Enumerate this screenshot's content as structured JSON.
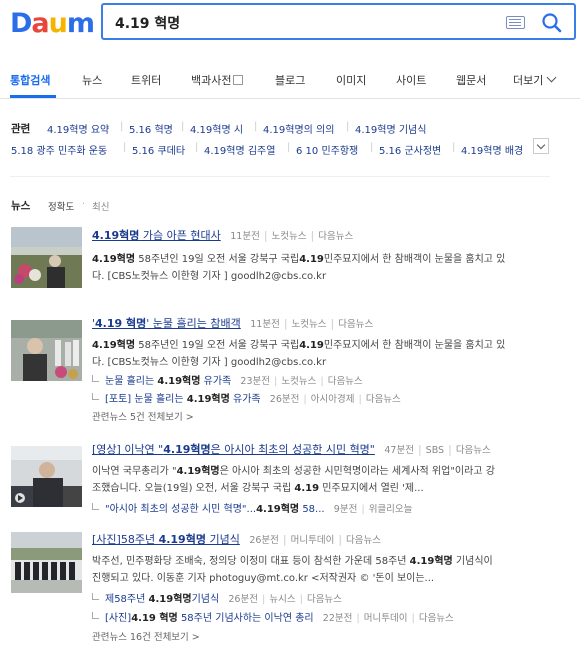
{
  "logo": {
    "letters": [
      "D",
      "a",
      "u",
      "m"
    ],
    "colors": [
      "#2b6ee8",
      "#e8463a",
      "#f4b400",
      "#2b6ee8"
    ]
  },
  "search": {
    "value": "4.19 혁명"
  },
  "tabs": [
    {
      "label": "통합검색",
      "active": true
    },
    {
      "label": "뉴스"
    },
    {
      "label": "트위터"
    },
    {
      "label": "백과사전"
    },
    {
      "label": "블로그"
    },
    {
      "label": "이미지"
    },
    {
      "label": "사이트"
    },
    {
      "label": "웹문서"
    },
    {
      "label": "더보기"
    }
  ],
  "related": {
    "title": "관련",
    "row1": [
      "4.19혁명 요약",
      "5.16 혁명",
      "4.19혁명 시",
      "4.19혁명의 의의",
      "4.19혁명 기념식"
    ],
    "row2": [
      "5.18 광주 민주화 운동",
      "5.16 쿠데타",
      "4.19혁명 김주열",
      "6 10 민주항쟁",
      "5.16 군사정변",
      "4.19혁명 배경"
    ]
  },
  "news": {
    "heading": "뉴스",
    "sort_accuracy": "정확도",
    "sort_recent": "최신",
    "items": [
      {
        "title": "4.19혁명 가슴 아픈 현대사",
        "time": "11분전",
        "source": "노컷뉴스",
        "daum": "다음뉴스",
        "lines": [
          "4.19혁명 58주년인 19일 오전 서울 강북구 국립4.19민주묘지에서 한 참배객이 눈물을 훔치고 있",
          "다. [CBS노컷뉴스 이한형 기자 ] goodlh2@cbs.co.kr"
        ]
      },
      {
        "title": "'4.19 혁명' 눈물 흘리는 참배객",
        "time": "11분전",
        "source": "노컷뉴스",
        "daum": "다음뉴스",
        "lines": [
          "4.19혁명 58주년인 19일 오전 서울 강북구 국립4.19민주묘지에서 한 참배객이 눈물을 훔치고 있",
          "다. [CBS노컷뉴스 이한형 기자 ] goodlh2@cbs.co.kr"
        ],
        "subs": [
          {
            "title": "눈물 흘리는 4.19혁명 유가족",
            "time": "23분전",
            "source": "노컷뉴스",
            "daum": "다음뉴스"
          },
          {
            "title": "[포토] 눈물 흘리는 4.19혁명 유가족",
            "time": "26분전",
            "source": "아시아경제",
            "daum": "다음뉴스"
          }
        ],
        "related": "관련뉴스 5건 전체보기 >"
      },
      {
        "title": "[영상] 이낙연 \"4.19혁명은 아시아 최초의 성공한 시민 혁명\"",
        "time": "47분전",
        "source": "SBS",
        "daum": "다음뉴스",
        "lines": [
          "이낙연 국무총리가 \"4.19혁명은 아시아 최초의 성공한 시민혁명이라는 세계사적 위업\"이라고 강",
          "조했습니다. 오늘(19일) 오전, 서울 강북구 국립 4.19 민주묘지에서 열린 '제..."
        ],
        "subs": [
          {
            "title": "\"아시아 최초의 성공한 시민 혁명\"...4.19혁명 58...",
            "time": "9분전",
            "source": "위클리오늘",
            "daum": ""
          }
        ]
      },
      {
        "title": "[사진]58주년 4.19혁명 기념식",
        "time": "26분전",
        "source": "머니투데이",
        "daum": "다음뉴스",
        "lines": [
          "박주선, 민주평화당 조배숙, 정의당 이정미 대표 등이 참석한 가운데 58주년 4.19혁명 기념식이",
          "진행되고 있다. 이동훈 기자 photoguy@mt.co.kr <저작권자 © '돈이 보이는..."
        ],
        "subs": [
          {
            "title": "제58주년 4.19혁명기념식",
            "time": "26분전",
            "source": "뉴시스",
            "daum": "다음뉴스"
          },
          {
            "title": "[사진]4.19 혁명 58주년 기념사하는 이낙연 총리",
            "time": "22분전",
            "source": "머니투데이",
            "daum": "다음뉴스"
          }
        ],
        "related": "관련뉴스 16건 전체보기 >"
      }
    ]
  }
}
